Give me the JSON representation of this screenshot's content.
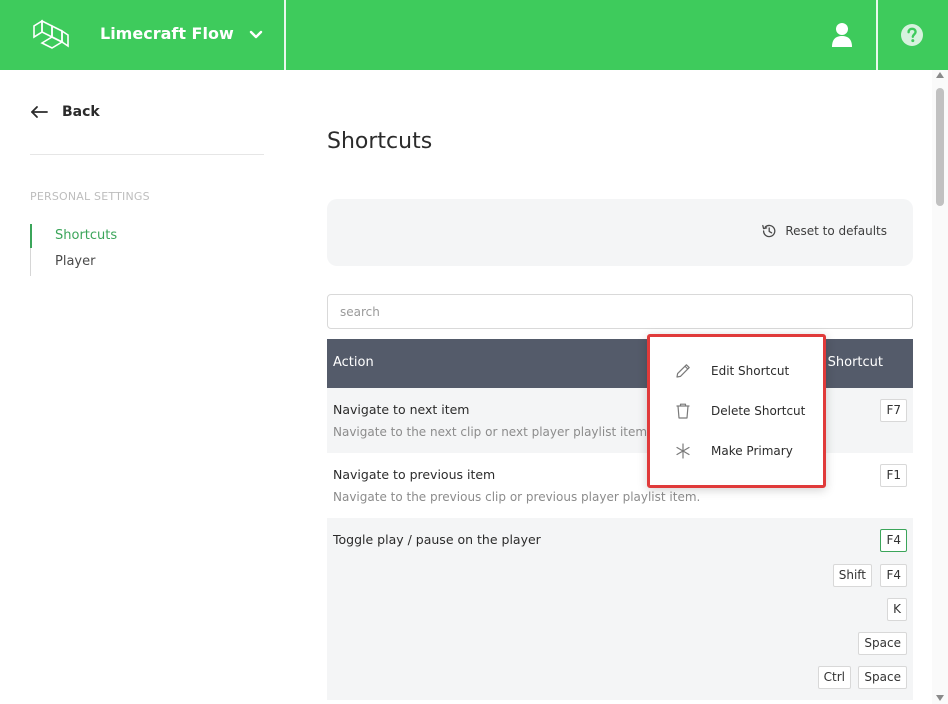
{
  "app": {
    "name": "Limecraft Flow",
    "logo_icon": "limecraft-logo-icon",
    "accent": "#3ecb5c"
  },
  "header": {
    "user_icon": "user-icon",
    "help_icon": "help-icon"
  },
  "sidebar": {
    "back_label": "Back",
    "section_heading": "PERSONAL SETTINGS",
    "items": [
      {
        "label": "Shortcuts",
        "active": true
      },
      {
        "label": "Player",
        "active": false
      }
    ]
  },
  "main": {
    "title": "Shortcuts",
    "reset_label": "Reset to defaults",
    "search_placeholder": "search",
    "table": {
      "columns": [
        "Action",
        "Shortcut"
      ],
      "rows": [
        {
          "title": "Navigate to next item",
          "description": "Navigate to the next clip or next player playlist item.",
          "shortcuts": [
            [
              "F7"
            ]
          ]
        },
        {
          "title": "Navigate to previous item",
          "description": "Navigate to the previous clip or previous player playlist item.",
          "shortcuts": [
            [
              "F1"
            ]
          ]
        },
        {
          "title": "Toggle play / pause on the player",
          "description": "",
          "shortcuts": [
            [
              "F4"
            ],
            [
              "Shift",
              "F4"
            ],
            [
              "K"
            ],
            [
              "Space"
            ],
            [
              "Ctrl",
              "Space"
            ]
          ]
        }
      ]
    }
  },
  "context_menu": {
    "items": [
      {
        "label": "Edit Shortcut",
        "icon": "pencil-icon"
      },
      {
        "label": "Delete Shortcut",
        "icon": "trash-icon"
      },
      {
        "label": "Make Primary",
        "icon": "asterisk-icon"
      }
    ],
    "highlight_color": "#e03a3a"
  }
}
